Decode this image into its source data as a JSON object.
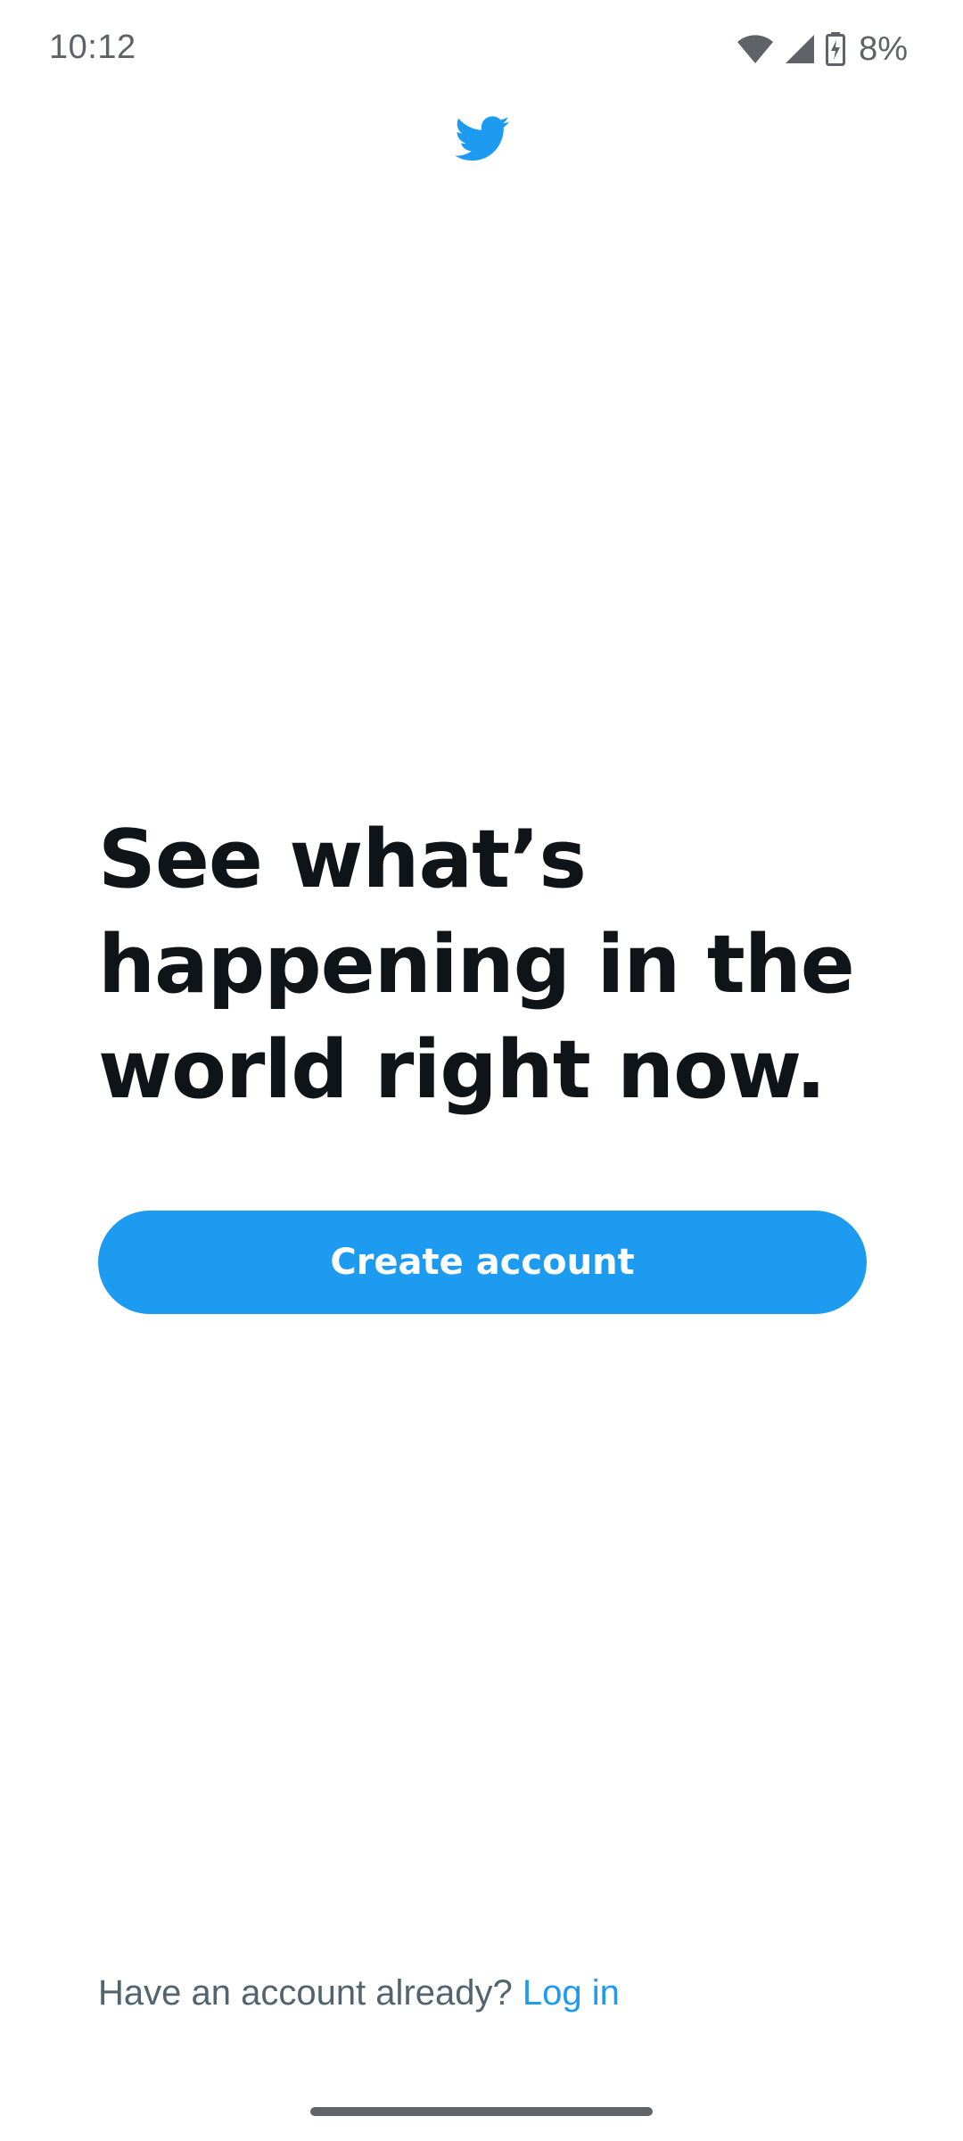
{
  "status_bar": {
    "time": "10:12",
    "battery_percent": "8%",
    "icons": [
      "wifi-icon",
      "cell-signal-icon",
      "battery-charging-icon"
    ]
  },
  "brand": {
    "logo_icon": "twitter-bird-icon",
    "accent_color": "#1d9bf0"
  },
  "main": {
    "headline_lines": [
      "See what’s",
      "happening in the",
      "world right now."
    ],
    "create_account_label": "Create account"
  },
  "footer": {
    "prompt_text": "Have an account already?",
    "login_label": "Log in"
  }
}
